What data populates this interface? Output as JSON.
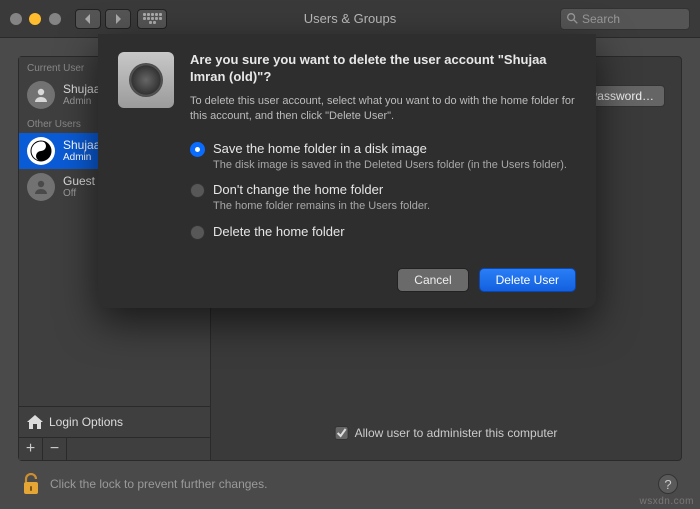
{
  "titlebar": {
    "title": "Users & Groups",
    "search_placeholder": "Search"
  },
  "sidebar": {
    "current_header": "Current User",
    "other_header": "Other Users",
    "users": [
      {
        "name": "Shujaa Imran",
        "role": "Admin"
      },
      {
        "name": "Shujaa Imran (old)",
        "role": "Admin"
      },
      {
        "name": "Guest User",
        "role": "Off"
      }
    ],
    "login_options": "Login Options"
  },
  "panel": {
    "change_password": "Change Password…",
    "admin_check": "Allow user to administer this computer"
  },
  "lock": {
    "text": "Click the lock to prevent further changes."
  },
  "dialog": {
    "title": "Are you sure you want to delete the user account \"Shujaa Imran (old)\"?",
    "subtitle": "To delete this user account, select what you want to do with the home folder for this account, and then click \"Delete User\".",
    "options": [
      {
        "label": "Save the home folder in a disk image",
        "desc": "The disk image is saved in the Deleted Users folder (in the Users folder).",
        "selected": true
      },
      {
        "label": "Don't change the home folder",
        "desc": "The home folder remains in the Users folder.",
        "selected": false
      },
      {
        "label": "Delete the home folder",
        "desc": "",
        "selected": false
      }
    ],
    "cancel": "Cancel",
    "confirm": "Delete User"
  },
  "watermark": "wsxdn.com"
}
